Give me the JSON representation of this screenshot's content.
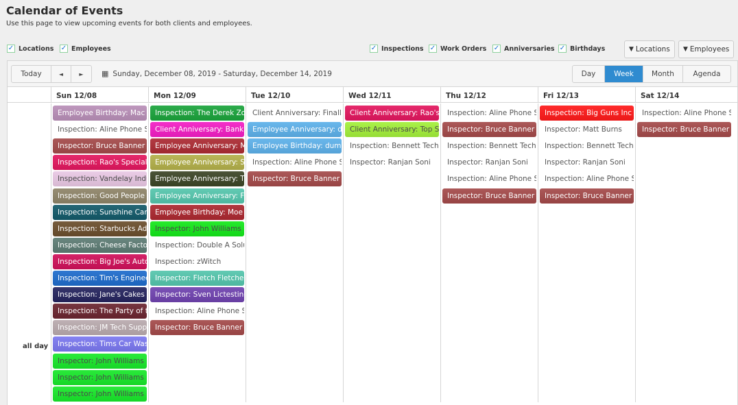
{
  "page": {
    "title": "Calendar of Events",
    "subtitle": "Use this page to view upcoming events for both clients and employees."
  },
  "filters": {
    "left": [
      {
        "label": "Locations",
        "checked": true
      },
      {
        "label": "Employees",
        "checked": true
      }
    ],
    "right": [
      {
        "label": "Inspections",
        "checked": true
      },
      {
        "label": "Work Orders",
        "checked": true
      },
      {
        "label": "Anniversaries",
        "checked": true
      },
      {
        "label": "Birthdays",
        "checked": true
      }
    ],
    "buttons": [
      {
        "label": "Locations",
        "icon": "filter-icon"
      },
      {
        "label": "Employees",
        "icon": "filter-icon"
      }
    ]
  },
  "toolbar": {
    "today": "Today",
    "prev": "◄",
    "next": "►",
    "date_range": "Sunday, December 08, 2019 - Saturday, December 14, 2019",
    "views": [
      {
        "label": "Day",
        "active": false
      },
      {
        "label": "Week",
        "active": true
      },
      {
        "label": "Month",
        "active": false
      },
      {
        "label": "Agenda",
        "active": false
      }
    ]
  },
  "all_day_label": "all day",
  "days": [
    {
      "header": "Sun 12/08",
      "events": [
        {
          "text": "Employee Birthday: Mac Ti",
          "color": "#b98fb8"
        },
        {
          "text": "Inspection: Aline Phone Sy",
          "color": ""
        },
        {
          "text": "Inspector: Bruce Banner",
          "color": "#a44a4a"
        },
        {
          "text": "Inspection: Rao's Specialty",
          "color": "#e3175f"
        },
        {
          "text": "Inspection: Vandelay Indus",
          "color": "#e9c8e4",
          "dark": true
        },
        {
          "text": "Inspection: Good People B",
          "color": "#8e8468"
        },
        {
          "text": "Inspection: Sunshine Carpe",
          "color": "#135a6a"
        },
        {
          "text": "Inspection: Starbucks Addi",
          "color": "#6b4e2d"
        },
        {
          "text": "Inspection: Cheese Factory",
          "color": "#5d7c74"
        },
        {
          "text": "Inspection: Big Joe's Auto S",
          "color": "#d0105a"
        },
        {
          "text": "Inspection: Tim's Engineer",
          "color": "#1e6ccc"
        },
        {
          "text": "Inspection: Jane's Cakes",
          "color": "#25245e"
        },
        {
          "text": "Inspection: The Party of th",
          "color": "#6b2530"
        },
        {
          "text": "Inspection: JM Tech Suppo",
          "color": "#b9aaae"
        },
        {
          "text": "Inspection: Tims Car Wash",
          "color": "#7b78f0"
        },
        {
          "text": "Inspector: John Williams",
          "color": "#18e82a",
          "dark": true
        },
        {
          "text": "Inspector: John Williams",
          "color": "#18e82a",
          "dark": true
        },
        {
          "text": "Inspector: John Williams",
          "color": "#18e82a",
          "dark": true
        }
      ]
    },
    {
      "header": "Mon 12/09",
      "events": [
        {
          "text": "Inspection: The Derek Zoo",
          "color": "#1ba43c"
        },
        {
          "text": "Client Anniversary: Bank o",
          "color": "#f31ec5"
        },
        {
          "text": "Employee Anniversary: Mo",
          "color": "#ac2b33"
        },
        {
          "text": "Employee Anniversary: Sa",
          "color": "#b3b04a"
        },
        {
          "text": "Employee Anniversary: Tin",
          "color": "#3c4526"
        },
        {
          "text": "Employee Anniversary: Fle",
          "color": "#55c6ad"
        },
        {
          "text": "Employee Birthday: Moe S",
          "color": "#ac2830"
        },
        {
          "text": "Inspector: John Williams",
          "color": "#14e81a",
          "dark": true
        },
        {
          "text": "Inspection: Double A Solut",
          "color": ""
        },
        {
          "text": "Inspection: zWitch",
          "color": ""
        },
        {
          "text": "Inspector: Fletch Fletcher",
          "color": "#55c6ad"
        },
        {
          "text": "Inspector: Sven Lictestine",
          "color": "#7043b0"
        },
        {
          "text": "Inspection: Aline Phone Sy",
          "color": ""
        },
        {
          "text": "Inspector: Bruce Banner",
          "color": "#a44a4a"
        }
      ]
    },
    {
      "header": "Tue 12/10",
      "events": [
        {
          "text": "Client Anniversary: Finally",
          "color": ""
        },
        {
          "text": "Employee Anniversary: du",
          "color": "#5db1ea"
        },
        {
          "text": "Employee Birthday: dumm",
          "color": "#5db1ea"
        },
        {
          "text": "Inspection: Aline Phone Sy",
          "color": ""
        },
        {
          "text": "Inspector: Bruce Banner",
          "color": "#a44a4a"
        }
      ]
    },
    {
      "header": "Wed 12/11",
      "events": [
        {
          "text": "Client Anniversary: Rao's S",
          "color": "#e3175f"
        },
        {
          "text": "Client Anniversary: Top Sh",
          "color": "#a3f03a",
          "dark": true
        },
        {
          "text": "Inspection: Bennett Tech",
          "color": ""
        },
        {
          "text": "Inspector: Ranjan Soni",
          "color": ""
        }
      ]
    },
    {
      "header": "Thu 12/12",
      "events": [
        {
          "text": "Inspection: Aline Phone Sy",
          "color": ""
        },
        {
          "text": "Inspector: Bruce Banner",
          "color": "#a44a4a"
        },
        {
          "text": "Inspection: Bennett Tech",
          "color": ""
        },
        {
          "text": "Inspector: Ranjan Soni",
          "color": ""
        },
        {
          "text": "Inspection: Aline Phone Sy",
          "color": ""
        },
        {
          "text": "Inspector: Bruce Banner",
          "color": "#a44a4a"
        }
      ]
    },
    {
      "header": "Fri 12/13",
      "events": [
        {
          "text": "Inspection: Big Guns Inc",
          "color": "#ff1a1a"
        },
        {
          "text": "Inspector: Matt Burns",
          "color": ""
        },
        {
          "text": "Inspection: Bennett Tech",
          "color": ""
        },
        {
          "text": "Inspector: Ranjan Soni",
          "color": ""
        },
        {
          "text": "Inspection: Aline Phone Sy",
          "color": ""
        },
        {
          "text": "Inspector: Bruce Banner",
          "color": "#a44a4a"
        }
      ]
    },
    {
      "header": "Sat 12/14",
      "events": [
        {
          "text": "Inspection: Aline Phone Sy",
          "color": ""
        },
        {
          "text": "Inspector: Bruce Banner",
          "color": "#a44a4a"
        }
      ]
    }
  ]
}
